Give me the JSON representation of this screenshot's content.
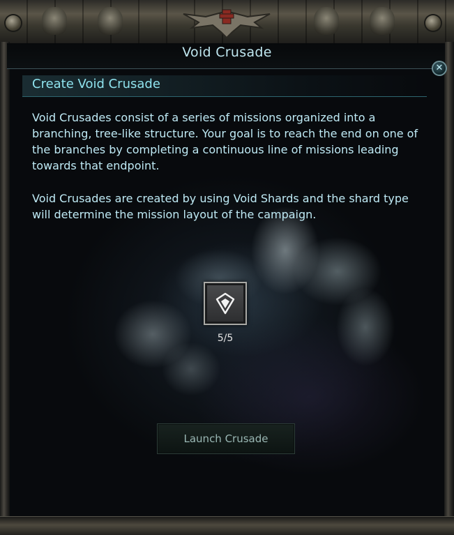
{
  "window": {
    "title": "Void Crusade",
    "close_icon": "close-icon"
  },
  "panel": {
    "header": "Create Void Crusade",
    "paragraph_1": "Void Crusades consist of a series of missions organized into a branching, tree-like structure. Your goal is to reach the end on one of the branches by completing a continuous line of missions leading towards that endpoint.",
    "paragraph_2": "Void Crusades are created by using Void Shards and the shard type will determine the mission layout of the campaign."
  },
  "shard": {
    "icon": "void-shard-icon",
    "count": "5/5"
  },
  "launch_button": {
    "label": "Launch Crusade"
  },
  "colors": {
    "title_text": "#bfe6ef",
    "header_text": "#8fe3ee",
    "body_text": "#bfeaf5",
    "button_text": "#9ab7b4"
  }
}
